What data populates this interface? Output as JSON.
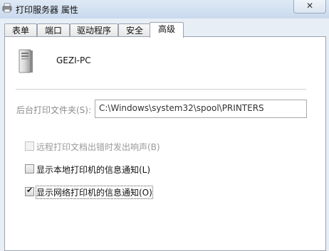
{
  "window": {
    "title": "打印服务器 属性",
    "close_glyph": "✕"
  },
  "tabs": [
    {
      "label": "表单",
      "active": false
    },
    {
      "label": "端口",
      "active": false
    },
    {
      "label": "驱动程序",
      "active": false
    },
    {
      "label": "安全",
      "active": false
    },
    {
      "label": "高级",
      "active": true
    }
  ],
  "advanced": {
    "server_icon": "computer-tower-icon",
    "server_name": "GEZI-PC",
    "spool_label": "后台打印文件夹(S):",
    "spool_path": "C:\\Windows\\system32\\spool\\PRINTERS",
    "options": [
      {
        "label": "远程打印文档出错时发出响声(B)",
        "checked": false,
        "enabled": false
      },
      {
        "label": "显示本地打印机的信息通知(L)",
        "checked": false,
        "enabled": true
      },
      {
        "label": "显示网络打印机的信息通知(O)",
        "checked": true,
        "enabled": true
      }
    ]
  },
  "colors": {
    "titlebar": "#c9d9ed",
    "panel": "#ffffff",
    "disabled_text": "#9a9a9a"
  }
}
